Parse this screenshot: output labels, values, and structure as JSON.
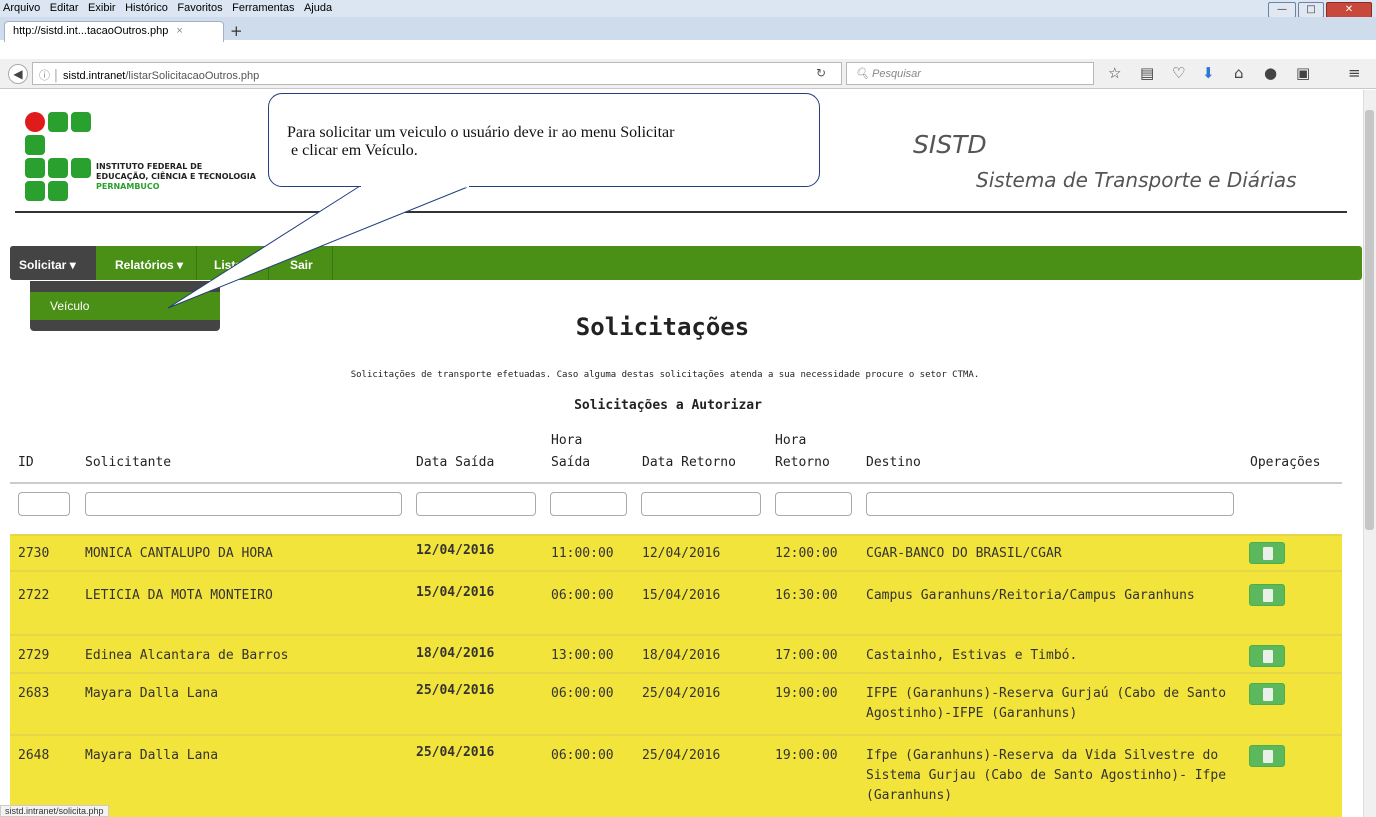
{
  "browser": {
    "menu": [
      "Arquivo",
      "Editar",
      "Exibir",
      "Histórico",
      "Favoritos",
      "Ferramentas",
      "Ajuda"
    ],
    "tab_title": "http://sistd.int...tacaoOutros.php",
    "tab_close": "×",
    "new_tab": "+",
    "url_host": "sistd.intranet",
    "url_path": "/listarSolicitacaoOutros.php",
    "search_placeholder": "Pesquisar",
    "status_url": "sistd.intranet/solicita.php"
  },
  "header": {
    "institute_line1": "INSTITUTO FEDERAL DE",
    "institute_line2": "EDUCAÇÃO, CIÊNCIA E TECNOLOGIA",
    "institute_line3": "PERNAMBUCO",
    "app_name": "SISTD",
    "app_full_name": "Sistema de Transporte e Diárias"
  },
  "nav": {
    "solicitar": "Solicitar",
    "relatorios": "Relatórios",
    "listar": "Listar",
    "sair": "Sair",
    "dropdown_item": "Veículo"
  },
  "callout": {
    "line1": "Para solicitar um veiculo o usuário deve ir ao menu Solicitar",
    "line2": " e clicar em Veículo."
  },
  "page": {
    "title": "Solicitações",
    "description": "Solicitações de transporte efetuadas. Caso alguma destas solicitações atenda a sua necessidade procure o setor CTMA.",
    "section_title": "Solicitações a Autorizar"
  },
  "table": {
    "headers": {
      "id": "ID",
      "solicitante": "Solicitante",
      "data_saida": "Data Saída",
      "hora_saida_1": "Hora",
      "hora_saida_2": "Saída",
      "data_retorno": "Data Retorno",
      "hora_retorno_1": "Hora",
      "hora_retorno_2": "Retorno",
      "destino": "Destino",
      "operacoes": "Operações"
    },
    "rows": [
      {
        "id": "2730",
        "solicitante": "MONICA CANTALUPO DA HORA",
        "data_saida": "12/04/2016",
        "hora_saida": "11:00:00",
        "data_retorno": "12/04/2016",
        "hora_retorno": "12:00:00",
        "destino": "CGAR-BANCO DO BRASIL/CGAR"
      },
      {
        "id": "2722",
        "solicitante": "LETICIA DA MOTA MONTEIRO",
        "data_saida": "15/04/2016",
        "hora_saida": "06:00:00",
        "data_retorno": "15/04/2016",
        "hora_retorno": "16:30:00",
        "destino": "Campus Garanhuns/Reitoria/Campus Garanhuns"
      },
      {
        "id": "2729",
        "solicitante": "Edinea Alcantara de Barros",
        "data_saida": "18/04/2016",
        "hora_saida": "13:00:00",
        "data_retorno": "18/04/2016",
        "hora_retorno": "17:00:00",
        "destino": "Castainho, Estivas e Timbó."
      },
      {
        "id": "2683",
        "solicitante": "Mayara Dalla Lana",
        "data_saida": "25/04/2016",
        "hora_saida": "06:00:00",
        "data_retorno": "25/04/2016",
        "hora_retorno": "19:00:00",
        "destino": "IFPE (Garanhuns)-Reserva Gurjaú (Cabo de Santo Agostinho)-IFPE (Garanhuns)"
      },
      {
        "id": "2648",
        "solicitante": "Mayara Dalla Lana",
        "data_saida": "25/04/2016",
        "hora_saida": "06:00:00",
        "data_retorno": "25/04/2016",
        "hora_retorno": "19:00:00",
        "destino": "Ifpe (Garanhuns)-Reserva da Vida Silvestre do Sistema Gurjau (Cabo de Santo Agostinho)- Ifpe (Garanhuns)"
      }
    ]
  },
  "colors": {
    "nav_green": "#4a8f16",
    "row_yellow": "#f3e43b",
    "op_button": "#5cb85c"
  }
}
